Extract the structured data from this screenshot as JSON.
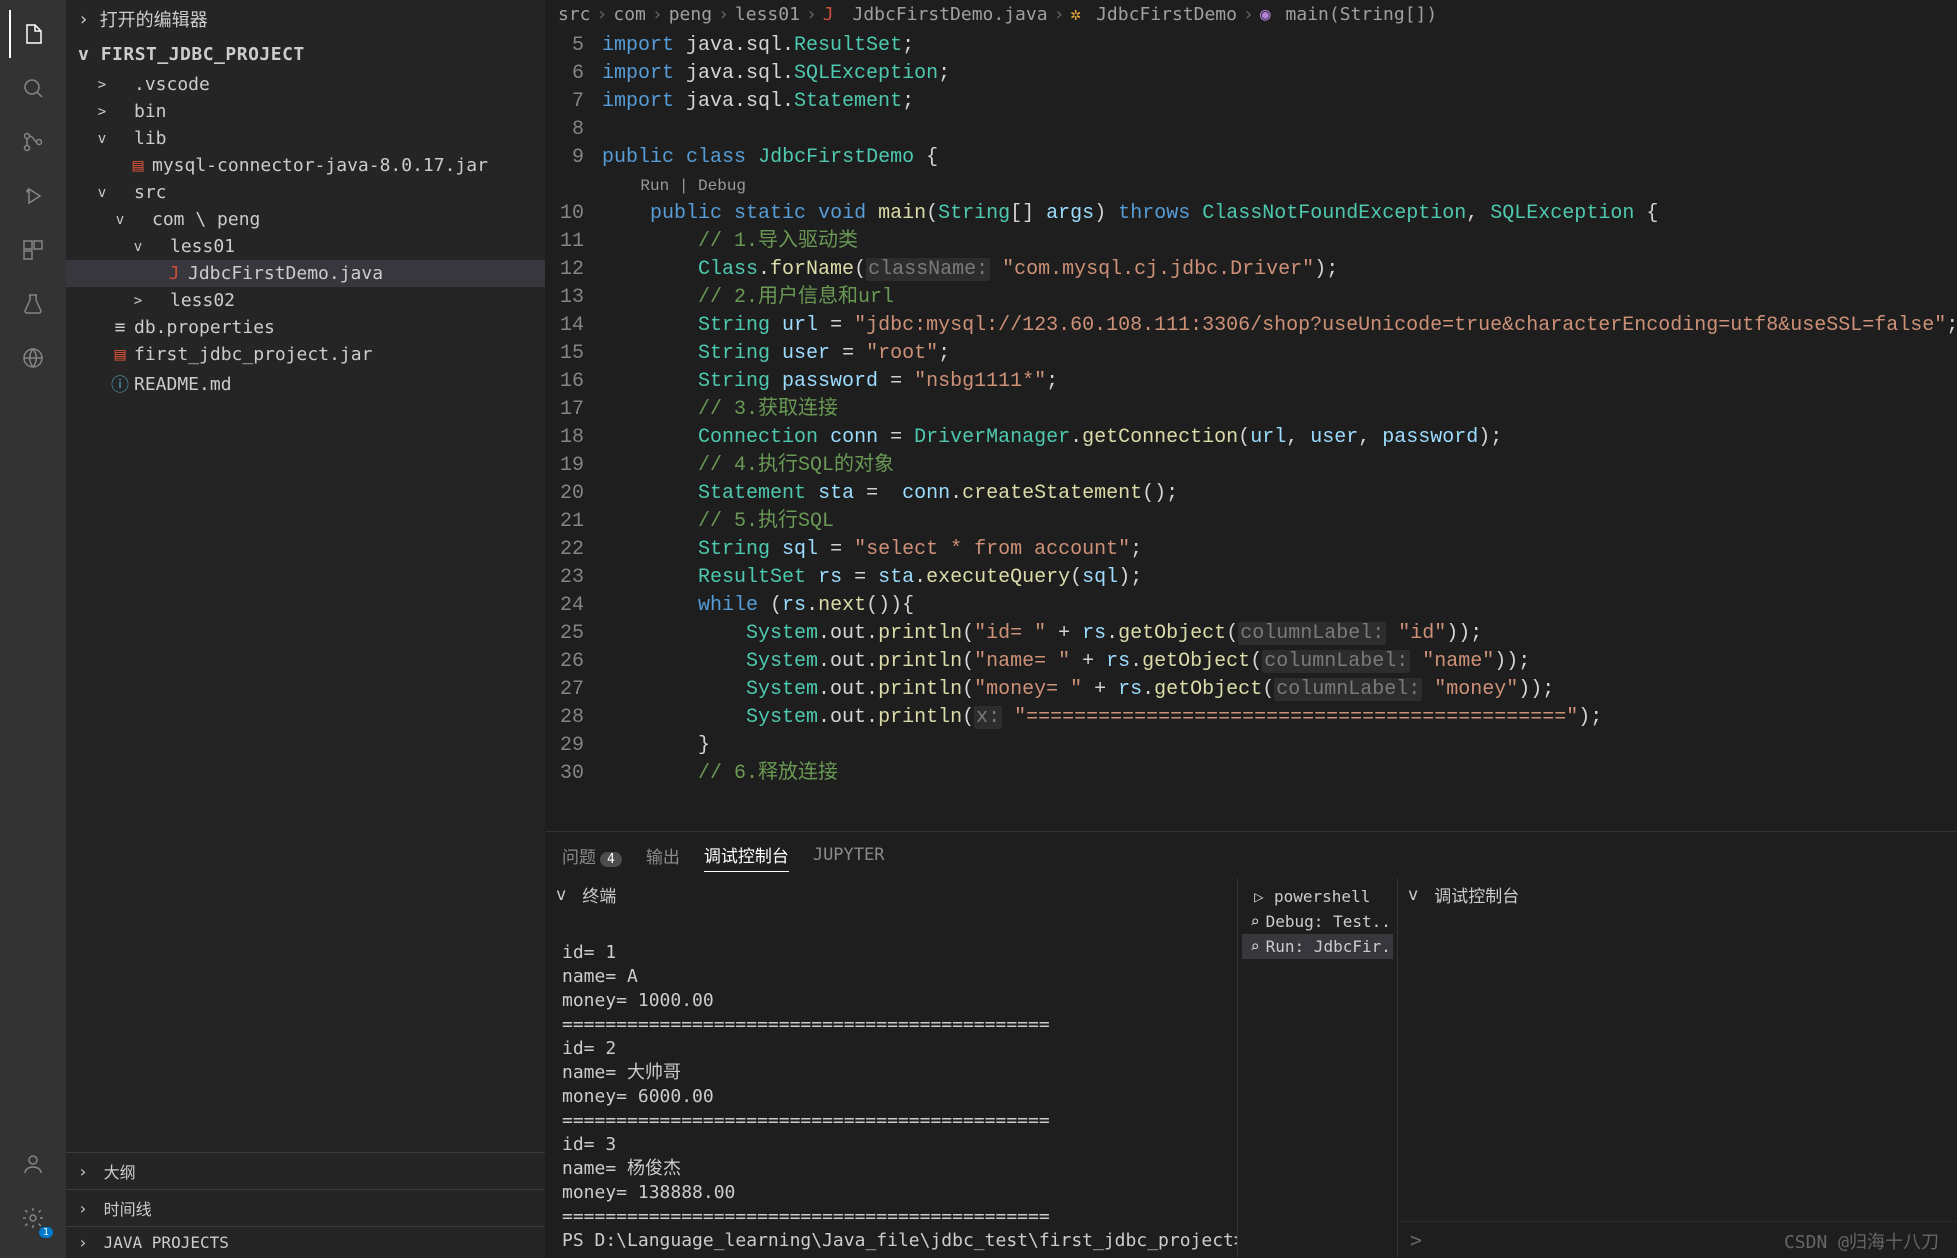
{
  "activity": {
    "icons": [
      "files",
      "search",
      "scm",
      "debug",
      "ext",
      "test",
      "docker"
    ]
  },
  "sidebar": {
    "openEditors": "打开的编辑器",
    "projectName": "FIRST_JDBC_PROJECT",
    "tree": [
      {
        "indent": 1,
        "chev": ">",
        "icon": "",
        "label": ".vscode"
      },
      {
        "indent": 1,
        "chev": ">",
        "icon": "",
        "label": "bin"
      },
      {
        "indent": 1,
        "chev": "v",
        "icon": "",
        "label": "lib"
      },
      {
        "indent": 2,
        "chev": "",
        "icon": "▤",
        "iconClass": "file-red",
        "label": "mysql-connector-java-8.0.17.jar"
      },
      {
        "indent": 1,
        "chev": "v",
        "icon": "",
        "label": "src"
      },
      {
        "indent": 2,
        "chev": "v",
        "icon": "",
        "label": "com \\ peng"
      },
      {
        "indent": 3,
        "chev": "v",
        "icon": "",
        "label": "less01"
      },
      {
        "indent": 4,
        "chev": "",
        "icon": "J",
        "iconClass": "file-red",
        "label": "JdbcFirstDemo.java",
        "selected": true
      },
      {
        "indent": 3,
        "chev": ">",
        "icon": "",
        "label": "less02"
      },
      {
        "indent": 1,
        "chev": "",
        "icon": "≡",
        "iconClass": "",
        "label": "db.properties"
      },
      {
        "indent": 1,
        "chev": "",
        "icon": "▤",
        "iconClass": "file-red",
        "label": "first_jdbc_project.jar"
      },
      {
        "indent": 1,
        "chev": "",
        "icon": "ⓘ",
        "iconClass": "file-blue",
        "label": "README.md"
      }
    ],
    "sections": [
      "大纲",
      "时间线",
      "JAVA PROJECTS"
    ]
  },
  "breadcrumb": {
    "parts": [
      "src",
      "com",
      "peng",
      "less01"
    ],
    "file": "JdbcFirstDemo.java",
    "class": "JdbcFirstDemo",
    "method": "main(String[])"
  },
  "code": {
    "start": 5,
    "lines": [
      [
        [
          "kw",
          "import"
        ],
        [
          "punc",
          " java.sql."
        ],
        [
          "type",
          "ResultSet"
        ],
        [
          "punc",
          ";"
        ]
      ],
      [
        [
          "kw",
          "import"
        ],
        [
          "punc",
          " java.sql."
        ],
        [
          "type",
          "SQLException"
        ],
        [
          "punc",
          ";"
        ]
      ],
      [
        [
          "kw",
          "import"
        ],
        [
          "punc",
          " java.sql."
        ],
        [
          "type",
          "Statement"
        ],
        [
          "punc",
          ";"
        ]
      ],
      [],
      [
        [
          "kw",
          "public"
        ],
        [
          "punc",
          " "
        ],
        [
          "kw",
          "class"
        ],
        [
          "punc",
          " "
        ],
        [
          "type",
          "JdbcFirstDemo"
        ],
        [
          "punc",
          " {"
        ]
      ],
      [
        [
          "codelens",
          "    Run | Debug"
        ]
      ],
      [
        [
          "punc",
          "    "
        ],
        [
          "kw",
          "public"
        ],
        [
          "punc",
          " "
        ],
        [
          "kw",
          "static"
        ],
        [
          "punc",
          " "
        ],
        [
          "kw",
          "void"
        ],
        [
          "punc",
          " "
        ],
        [
          "fn",
          "main"
        ],
        [
          "punc",
          "("
        ],
        [
          "type",
          "String"
        ],
        [
          "punc",
          "[] "
        ],
        [
          "var",
          "args"
        ],
        [
          "punc",
          ") "
        ],
        [
          "kw",
          "throws"
        ],
        [
          "punc",
          " "
        ],
        [
          "type",
          "ClassNotFoundException"
        ],
        [
          "punc",
          ", "
        ],
        [
          "type",
          "SQLException"
        ],
        [
          "punc",
          " {"
        ]
      ],
      [
        [
          "punc",
          "        "
        ],
        [
          "com",
          "// 1.导入驱动类"
        ]
      ],
      [
        [
          "punc",
          "        "
        ],
        [
          "type",
          "Class"
        ],
        [
          "punc",
          "."
        ],
        [
          "fn",
          "forName"
        ],
        [
          "punc",
          "("
        ],
        [
          "hint",
          "className:"
        ],
        [
          "punc",
          " "
        ],
        [
          "str",
          "\"com.mysql.cj.jdbc.Driver\""
        ],
        [
          "punc",
          ");"
        ]
      ],
      [
        [
          "punc",
          "        "
        ],
        [
          "com",
          "// 2.用户信息和url"
        ]
      ],
      [
        [
          "punc",
          "        "
        ],
        [
          "type",
          "String"
        ],
        [
          "punc",
          " "
        ],
        [
          "var",
          "url"
        ],
        [
          "punc",
          " = "
        ],
        [
          "str",
          "\"jdbc:mysql://123.60.108.111:3306/shop?useUnicode=true&characterEncoding=utf8&useSSL=false\""
        ],
        [
          "punc",
          ";"
        ]
      ],
      [
        [
          "punc",
          "        "
        ],
        [
          "type",
          "String"
        ],
        [
          "punc",
          " "
        ],
        [
          "var",
          "user"
        ],
        [
          "punc",
          " = "
        ],
        [
          "str",
          "\"root\""
        ],
        [
          "punc",
          ";"
        ]
      ],
      [
        [
          "punc",
          "        "
        ],
        [
          "type",
          "String"
        ],
        [
          "punc",
          " "
        ],
        [
          "var",
          "password"
        ],
        [
          "punc",
          " = "
        ],
        [
          "str",
          "\"nsbg1111*\""
        ],
        [
          "punc",
          ";"
        ]
      ],
      [
        [
          "punc",
          "        "
        ],
        [
          "com",
          "// 3.获取连接"
        ]
      ],
      [
        [
          "punc",
          "        "
        ],
        [
          "type",
          "Connection"
        ],
        [
          "punc",
          " "
        ],
        [
          "var",
          "conn"
        ],
        [
          "punc",
          " = "
        ],
        [
          "type",
          "DriverManager"
        ],
        [
          "punc",
          "."
        ],
        [
          "fn",
          "getConnection"
        ],
        [
          "punc",
          "("
        ],
        [
          "var",
          "url"
        ],
        [
          "punc",
          ", "
        ],
        [
          "var",
          "user"
        ],
        [
          "punc",
          ", "
        ],
        [
          "var",
          "password"
        ],
        [
          "punc",
          ");"
        ]
      ],
      [
        [
          "punc",
          "        "
        ],
        [
          "com",
          "// 4.执行SQL的对象"
        ]
      ],
      [
        [
          "punc",
          "        "
        ],
        [
          "type",
          "Statement"
        ],
        [
          "punc",
          " "
        ],
        [
          "var",
          "sta"
        ],
        [
          "punc",
          " =  "
        ],
        [
          "var",
          "conn"
        ],
        [
          "punc",
          "."
        ],
        [
          "fn",
          "createStatement"
        ],
        [
          "punc",
          "();"
        ]
      ],
      [
        [
          "punc",
          "        "
        ],
        [
          "com",
          "// 5.执行SQL"
        ]
      ],
      [
        [
          "punc",
          "        "
        ],
        [
          "type",
          "String"
        ],
        [
          "punc",
          " "
        ],
        [
          "var",
          "sql"
        ],
        [
          "punc",
          " = "
        ],
        [
          "str",
          "\"select * from account\""
        ],
        [
          "punc",
          ";"
        ]
      ],
      [
        [
          "punc",
          "        "
        ],
        [
          "type",
          "ResultSet"
        ],
        [
          "punc",
          " "
        ],
        [
          "var",
          "rs"
        ],
        [
          "punc",
          " = "
        ],
        [
          "var",
          "sta"
        ],
        [
          "punc",
          "."
        ],
        [
          "fn",
          "executeQuery"
        ],
        [
          "punc",
          "("
        ],
        [
          "var",
          "sql"
        ],
        [
          "punc",
          ");"
        ]
      ],
      [
        [
          "punc",
          "        "
        ],
        [
          "kw",
          "while"
        ],
        [
          "punc",
          " ("
        ],
        [
          "var",
          "rs"
        ],
        [
          "punc",
          "."
        ],
        [
          "fn",
          "next"
        ],
        [
          "punc",
          "()){"
        ]
      ],
      [
        [
          "punc",
          "            "
        ],
        [
          "type",
          "System"
        ],
        [
          "punc",
          ".out."
        ],
        [
          "fn",
          "println"
        ],
        [
          "punc",
          "("
        ],
        [
          "str",
          "\"id= \""
        ],
        [
          "punc",
          " + "
        ],
        [
          "var",
          "rs"
        ],
        [
          "punc",
          "."
        ],
        [
          "fn",
          "getObject"
        ],
        [
          "punc",
          "("
        ],
        [
          "hint",
          "columnLabel:"
        ],
        [
          "punc",
          " "
        ],
        [
          "str",
          "\"id\""
        ],
        [
          "punc",
          "));"
        ]
      ],
      [
        [
          "punc",
          "            "
        ],
        [
          "type",
          "System"
        ],
        [
          "punc",
          ".out."
        ],
        [
          "fn",
          "println"
        ],
        [
          "punc",
          "("
        ],
        [
          "str",
          "\"name= \""
        ],
        [
          "punc",
          " + "
        ],
        [
          "var",
          "rs"
        ],
        [
          "punc",
          "."
        ],
        [
          "fn",
          "getObject"
        ],
        [
          "punc",
          "("
        ],
        [
          "hint",
          "columnLabel:"
        ],
        [
          "punc",
          " "
        ],
        [
          "str",
          "\"name\""
        ],
        [
          "punc",
          "));"
        ]
      ],
      [
        [
          "punc",
          "            "
        ],
        [
          "type",
          "System"
        ],
        [
          "punc",
          ".out."
        ],
        [
          "fn",
          "println"
        ],
        [
          "punc",
          "("
        ],
        [
          "str",
          "\"money= \""
        ],
        [
          "punc",
          " + "
        ],
        [
          "var",
          "rs"
        ],
        [
          "punc",
          "."
        ],
        [
          "fn",
          "getObject"
        ],
        [
          "punc",
          "("
        ],
        [
          "hint",
          "columnLabel:"
        ],
        [
          "punc",
          " "
        ],
        [
          "str",
          "\"money\""
        ],
        [
          "punc",
          "));"
        ]
      ],
      [
        [
          "punc",
          "            "
        ],
        [
          "type",
          "System"
        ],
        [
          "punc",
          ".out."
        ],
        [
          "fn",
          "println"
        ],
        [
          "punc",
          "("
        ],
        [
          "hint",
          "x:"
        ],
        [
          "punc",
          " "
        ],
        [
          "str",
          "\"=============================================\""
        ],
        [
          "punc",
          ");"
        ]
      ],
      [
        [
          "punc",
          "        }"
        ]
      ],
      [
        [
          "punc",
          "        "
        ],
        [
          "com",
          "// 6.释放连接"
        ]
      ]
    ],
    "skipLineNumberAt": 5
  },
  "panelTabs": {
    "problems": "问题",
    "problemsCount": "4",
    "output": "输出",
    "debugConsole": "调试控制台",
    "jupyter": "JUPYTER"
  },
  "terminal": {
    "header": "终端",
    "output": "\nid= 1\nname= A\nmoney= 1000.00\n=============================================\nid= 2\nname= 大帅哥\nmoney= 6000.00\n=============================================\nid= 3\nname= 杨俊杰\nmoney= 138888.00\n=============================================\nPS D:\\Language_learning\\Java_file\\jdbc_test\\first_jdbc_project>",
    "list": [
      {
        "icon": "▷",
        "label": "powershell"
      },
      {
        "icon": "⌕",
        "label": "Debug: Test..."
      },
      {
        "icon": "⌕",
        "label": "Run: JdbcFir...",
        "active": true
      }
    ]
  },
  "debugConsole": {
    "header": "调试控制台",
    "prompt": ">"
  },
  "watermark": "CSDN @归海十八刀"
}
